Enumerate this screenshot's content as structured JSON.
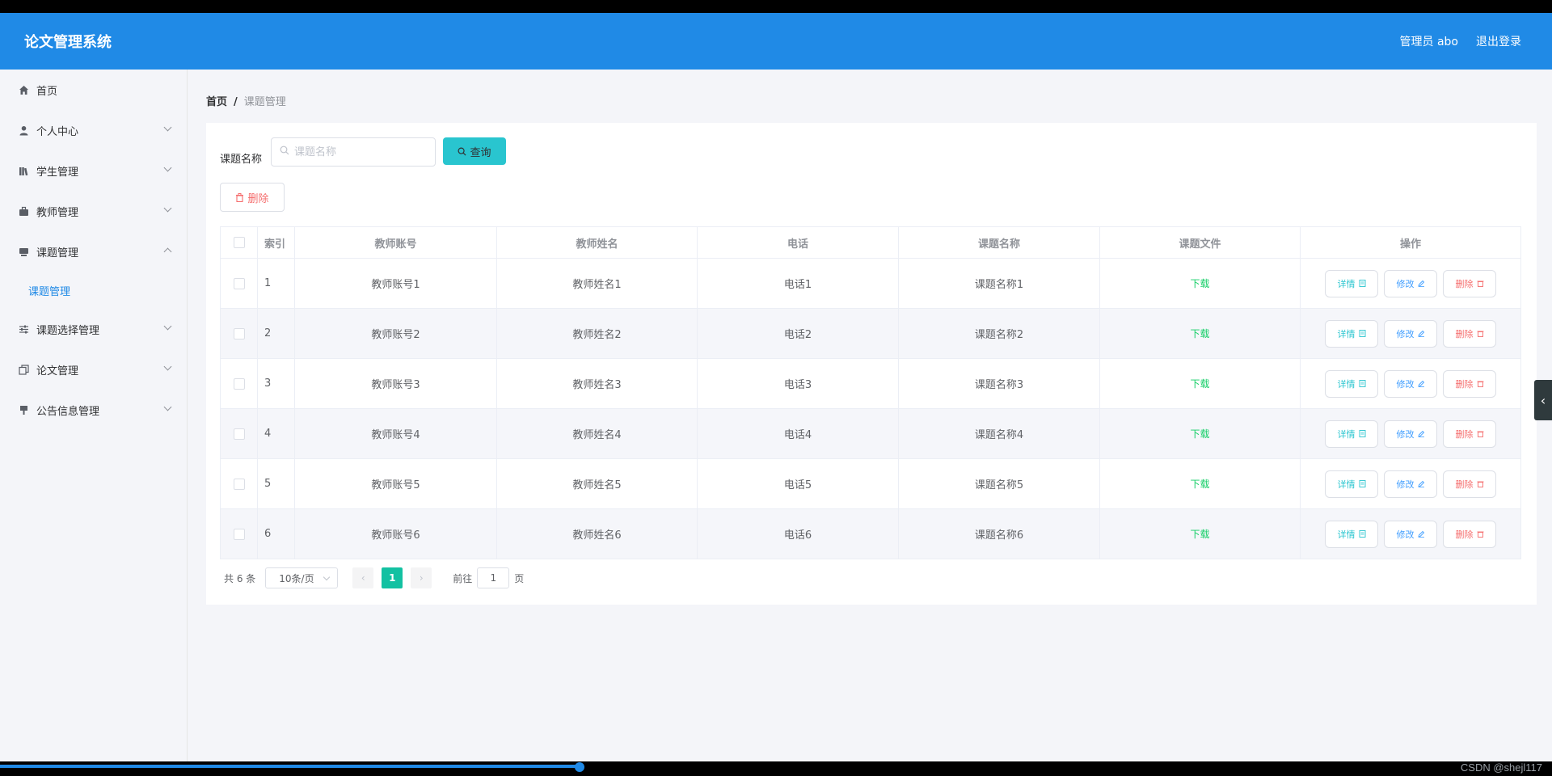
{
  "header": {
    "brand": "论文管理系统",
    "user": "管理员 abo",
    "logout": "退出登录"
  },
  "sidebar": {
    "items": [
      {
        "label": "首页",
        "icon": "home-icon"
      },
      {
        "label": "个人中心",
        "icon": "user-icon"
      },
      {
        "label": "学生管理",
        "icon": "books-icon"
      },
      {
        "label": "教师管理",
        "icon": "briefcase-icon"
      },
      {
        "label": "课题管理",
        "icon": "monitor-icon"
      },
      {
        "label": "课题选择管理",
        "icon": "sliders-icon"
      },
      {
        "label": "论文管理",
        "icon": "copy-icon"
      },
      {
        "label": "公告信息管理",
        "icon": "megaphone-icon"
      }
    ],
    "submenu": {
      "label": "课题管理"
    }
  },
  "breadcrumb": {
    "home": "首页",
    "sep": "/",
    "current": "课题管理"
  },
  "search": {
    "label": "课题名称",
    "placeholder": "课题名称",
    "query_label": "查询"
  },
  "toolbar": {
    "delete_label": "删除"
  },
  "table": {
    "headers": [
      "索引",
      "教师账号",
      "教师姓名",
      "电话",
      "课题名称",
      "课题文件",
      "操作"
    ],
    "rows": [
      {
        "idx": "1",
        "account": "教师账号1",
        "name": "教师姓名1",
        "phone": "电话1",
        "topic": "课题名称1",
        "file": "下载"
      },
      {
        "idx": "2",
        "account": "教师账号2",
        "name": "教师姓名2",
        "phone": "电话2",
        "topic": "课题名称2",
        "file": "下载"
      },
      {
        "idx": "3",
        "account": "教师账号3",
        "name": "教师姓名3",
        "phone": "电话3",
        "topic": "课题名称3",
        "file": "下载"
      },
      {
        "idx": "4",
        "account": "教师账号4",
        "name": "教师姓名4",
        "phone": "电话4",
        "topic": "课题名称4",
        "file": "下载"
      },
      {
        "idx": "5",
        "account": "教师账号5",
        "name": "教师姓名5",
        "phone": "电话5",
        "topic": "课题名称5",
        "file": "下载"
      },
      {
        "idx": "6",
        "account": "教师账号6",
        "name": "教师姓名6",
        "phone": "电话6",
        "topic": "课题名称6",
        "file": "下载"
      }
    ],
    "actions": {
      "detail": "详情",
      "edit": "修改",
      "remove": "删除"
    }
  },
  "pager": {
    "total": "共 6 条",
    "page_size": "10条/页",
    "current": "1",
    "goto_prefix": "前往",
    "goto_value": "1",
    "goto_suffix": "页"
  },
  "watermark": "CSDN @shejl117",
  "colors": {
    "header_bg": "#208ae6",
    "accent_cyan": "#29c5cf",
    "page_active": "#13c1a2",
    "danger": "#f56c6c",
    "download": "#13ce66"
  }
}
